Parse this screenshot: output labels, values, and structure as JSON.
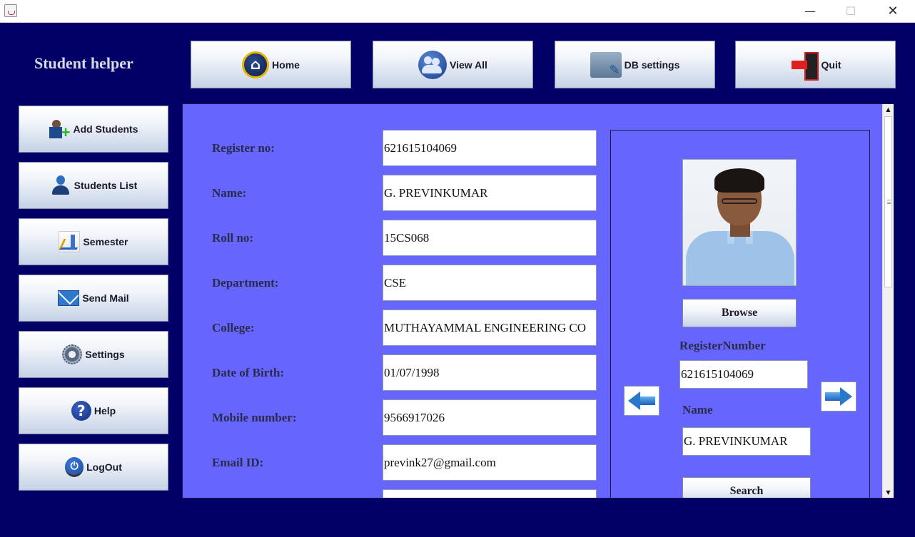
{
  "window": {
    "minimize_glyph": "—",
    "maximize_glyph": "☐",
    "close_glyph": "✕"
  },
  "app": {
    "title": "Student helper"
  },
  "topnav": {
    "home": {
      "label": "Home",
      "icon": "home-icon"
    },
    "view_all": {
      "label": "View All",
      "icon": "users-icon"
    },
    "db_settings": {
      "label": "DB settings",
      "icon": "folder-settings-icon"
    },
    "quit": {
      "label": "Quit",
      "icon": "exit-door-icon"
    }
  },
  "sidebar": {
    "items": [
      {
        "label": "Add Students",
        "icon": "add-user-icon"
      },
      {
        "label": "Students List",
        "icon": "user-icon"
      },
      {
        "label": "Semester",
        "icon": "chart-icon"
      },
      {
        "label": "Send Mail",
        "icon": "mail-icon"
      },
      {
        "label": "Settings",
        "icon": "gear-icon"
      },
      {
        "label": "Help",
        "icon": "help-icon",
        "glyph": "?"
      },
      {
        "label": "LogOut",
        "icon": "logout-icon",
        "glyph": "⏻"
      }
    ]
  },
  "form": {
    "fields": [
      {
        "label": "Register no:",
        "value": "621615104069"
      },
      {
        "label": "Name:",
        "value": "G. PREVINKUMAR"
      },
      {
        "label": "Roll no:",
        "value": "15CS068"
      },
      {
        "label": "Department:",
        "value": "CSE"
      },
      {
        "label": "College:",
        "value": "MUTHAYAMMAL ENGINEERING CO"
      },
      {
        "label": "Date of Birth:",
        "value": "01/07/1998"
      },
      {
        "label": "Mobile number:",
        "value": "9566917026"
      },
      {
        "label": "Email ID:",
        "value": "prevink27@gmail.com"
      },
      {
        "label": "",
        "value": ""
      }
    ]
  },
  "panel": {
    "browse_label": "Browse",
    "register_number_label": "RegisterNumber",
    "register_number_value": "621615104069",
    "name_label": "Name",
    "name_value": "G. PREVINKUMAR",
    "search_label": "Search",
    "prev_icon": "arrow-left-icon",
    "next_icon": "arrow-right-icon"
  },
  "scrollbar": {
    "up_glyph": "▲",
    "down_glyph": "▼"
  },
  "colors": {
    "background": "#000066",
    "panel": "#6666ff",
    "label_text": "#2a2a4a"
  }
}
